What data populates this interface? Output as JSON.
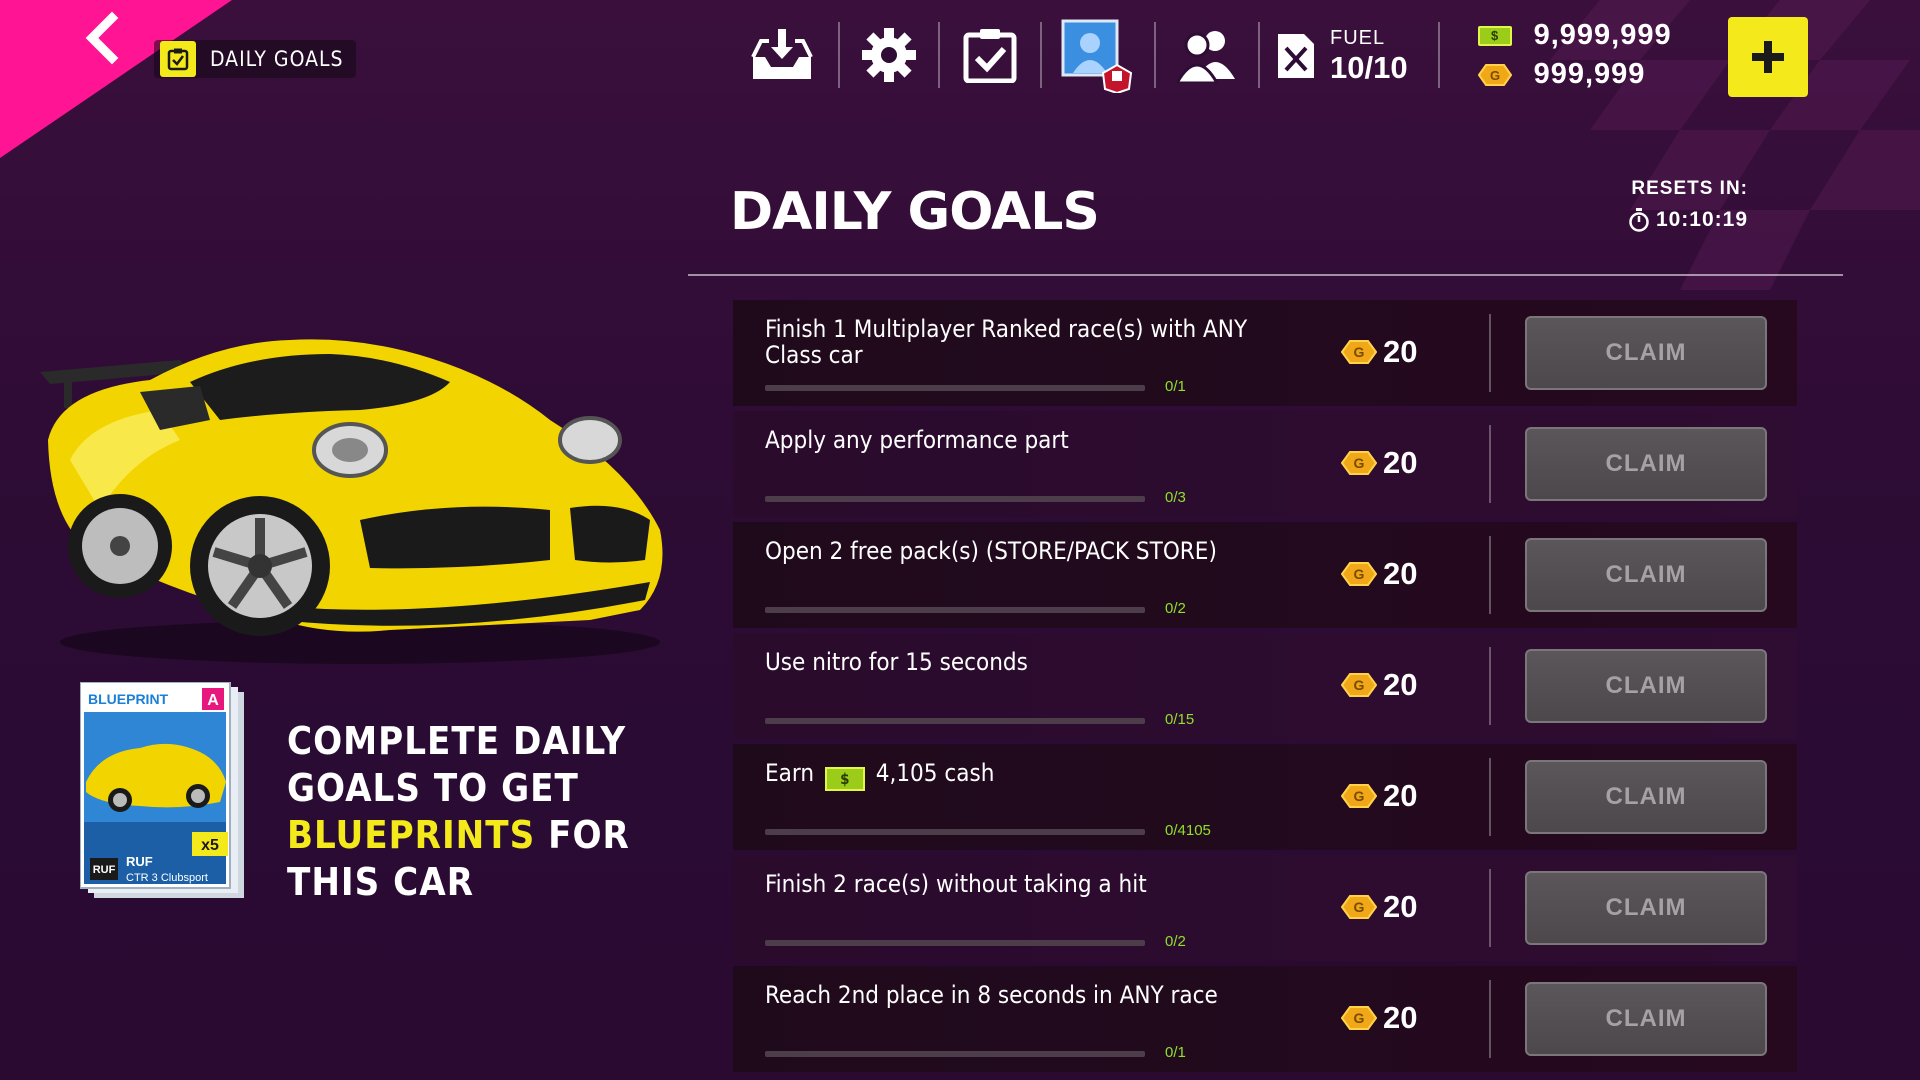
{
  "header": {
    "tag_label": "DAILY GOALS"
  },
  "topbar": {
    "fuel_label": "FUEL",
    "fuel_value": "10/10",
    "cash": "9,999,999",
    "gold": "999,999",
    "cash_symbol": "$",
    "gold_symbol": "G"
  },
  "panel": {
    "title": "DAILY GOALS",
    "resets_label": "RESETS IN:",
    "resets_time": "10:10:19"
  },
  "goals": [
    {
      "text": "Finish 1 Multiplayer Ranked race(s) with ANY Class car",
      "progress": "0/1",
      "progress_fraction": 0,
      "reward": "20",
      "claim": "CLAIM"
    },
    {
      "text": "Apply any performance part",
      "progress": "0/3",
      "progress_fraction": 0,
      "reward": "20",
      "claim": "CLAIM"
    },
    {
      "text": "Open 2 free pack(s) (STORE/PACK STORE)",
      "progress": "0/2",
      "progress_fraction": 0,
      "reward": "20",
      "claim": "CLAIM"
    },
    {
      "text": "Use nitro for 15 seconds",
      "progress": "0/15",
      "progress_fraction": 0,
      "reward": "20",
      "claim": "CLAIM"
    },
    {
      "text_prefix": "Earn",
      "text_cash_symbol": "$",
      "text_suffix": "4,105 cash",
      "progress": "0/4105",
      "progress_fraction": 0,
      "reward": "20",
      "claim": "CLAIM"
    },
    {
      "text": "Finish 2 race(s) without taking a hit",
      "progress": "0/2",
      "progress_fraction": 0,
      "reward": "20",
      "claim": "CLAIM"
    },
    {
      "text": "Reach 2nd place in 8 seconds in ANY race",
      "progress": "0/1",
      "progress_fraction": 0,
      "reward": "20",
      "claim": "CLAIM"
    }
  ],
  "blueprint": {
    "label": "BLUEPRINT",
    "class": "A",
    "count": "x5",
    "brand": "RUF",
    "model": "CTR 3 Clubsport"
  },
  "promo": {
    "line1": "COMPLETE DAILY",
    "line2": "GOALS TO GET",
    "highlight": "BLUEPRINTS",
    "line3_rest": " FOR",
    "line4": "THIS CAR"
  },
  "colors": {
    "accent_yellow": "#f4e91b",
    "accent_pink": "#ff1493",
    "progress_green": "#8ee02a",
    "background": "#2e0c35"
  }
}
